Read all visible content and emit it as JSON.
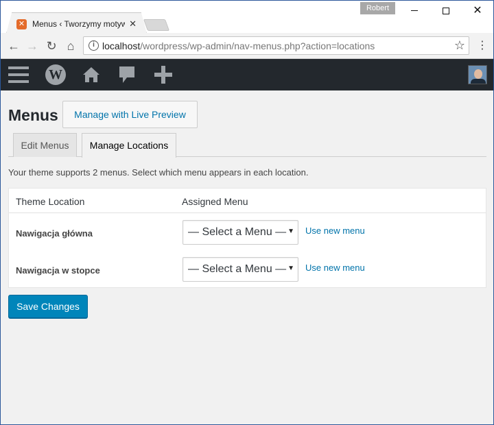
{
  "browser": {
    "profile_name": "Robert",
    "tab_title": "Menus ‹ Tworzymy motyw",
    "url_host": "localhost",
    "url_path": "/wordpress/wp-admin/nav-menus.php?action=locations"
  },
  "adminbar": {
    "icons": [
      "menu-icon",
      "wordpress-logo-icon",
      "home-icon",
      "comments-icon",
      "plus-icon"
    ],
    "avatar": "user-avatar"
  },
  "page": {
    "title": "Menus",
    "preview_button": "Manage with Live Preview",
    "tabs": [
      {
        "label": "Edit Menus",
        "active": false
      },
      {
        "label": "Manage Locations",
        "active": true
      }
    ],
    "intro": "Your theme supports 2 menus. Select which menu appears in each location.",
    "table": {
      "headers": [
        "Theme Location",
        "Assigned Menu"
      ],
      "rows": [
        {
          "location": "Nawigacja główna",
          "selected": "— Select a Menu —",
          "link": "Use new menu"
        },
        {
          "location": "Nawigacja w stopce",
          "selected": "— Select a Menu —",
          "link": "Use new menu"
        }
      ]
    },
    "save_button": "Save Changes"
  },
  "colors": {
    "accent": "#0073aa",
    "primary_button": "#0085ba",
    "adminbar": "#23282d",
    "background": "#f1f1f1"
  }
}
